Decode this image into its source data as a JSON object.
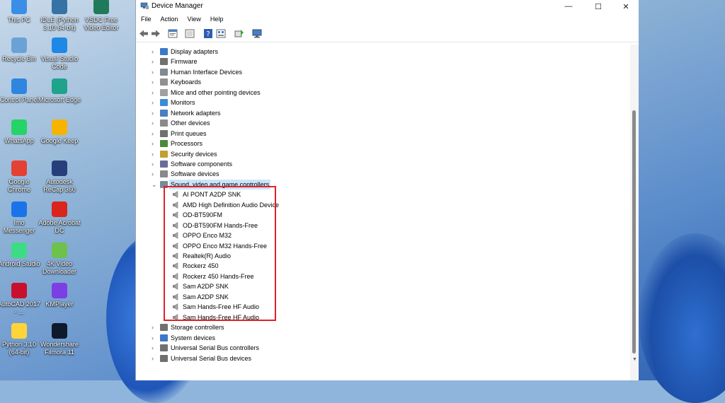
{
  "desktop": {
    "icons": [
      {
        "label": "This PC",
        "icon": "pc-icon",
        "color": "#3a8ee6"
      },
      {
        "label": "IDLE (Python 3.10 64-bit)",
        "icon": "python-idle-icon",
        "color": "#3572a5"
      },
      {
        "label": "VSDC Free Video Editor",
        "icon": "vsdc-icon",
        "color": "#1f7a5a"
      },
      {
        "label": "Recycle Bin",
        "icon": "recycle-bin-icon",
        "color": "#6aa2d8"
      },
      {
        "label": "Visual Studio Code",
        "icon": "vscode-icon",
        "color": "#1e88e5"
      },
      {
        "label": "Control Panel",
        "icon": "control-panel-icon",
        "color": "#2e86de"
      },
      {
        "label": "Microsoft Edge",
        "icon": "edge-icon",
        "color": "#1fa38a"
      },
      {
        "label": "WhatsApp",
        "icon": "whatsapp-icon",
        "color": "#25d366"
      },
      {
        "label": "Google Keep",
        "icon": "google-keep-icon",
        "color": "#f6b400"
      },
      {
        "label": "Google Chrome",
        "icon": "chrome-icon",
        "color": "#e44134"
      },
      {
        "label": "Autodesk ReCap 360",
        "icon": "recap-icon",
        "color": "#263f7a"
      },
      {
        "label": "Imo Messenger",
        "icon": "imo-icon",
        "color": "#1a73e8"
      },
      {
        "label": "Adobe Acrobat DC",
        "icon": "acrobat-icon",
        "color": "#d9251c"
      },
      {
        "label": "Android Studio",
        "icon": "android-studio-icon",
        "color": "#3ddc84"
      },
      {
        "label": "4K Video Downloader",
        "icon": "4k-downloader-icon",
        "color": "#6cc24a"
      },
      {
        "label": "AutoCAD 2017 - ...",
        "icon": "autocad-icon",
        "color": "#c8102e"
      },
      {
        "label": "KMPlayer",
        "icon": "kmplayer-icon",
        "color": "#7b3fe4"
      },
      {
        "label": "Python 3.10 (64-bit)",
        "icon": "python-icon",
        "color": "#ffd43b"
      },
      {
        "label": "Wondershare Filmora 11",
        "icon": "filmora-icon",
        "color": "#0e1a2b"
      }
    ]
  },
  "window": {
    "title": "Device Manager",
    "controls": {
      "minimize": "—",
      "maximize": "☐",
      "close": "✕"
    },
    "menu": [
      "File",
      "Action",
      "View",
      "Help"
    ],
    "toolbar": [
      "back-icon",
      "forward-icon",
      "properties-icon",
      "show-hidden-icon",
      "help-icon",
      "view-icon",
      "update-driver-icon",
      "scan-hardware-icon"
    ]
  },
  "tree": {
    "categories_before": [
      {
        "label": "Display adapters",
        "icon": "display-adapter-icon",
        "color": "#3c78c8"
      },
      {
        "label": "Firmware",
        "icon": "firmware-icon",
        "color": "#707070"
      },
      {
        "label": "Human Interface Devices",
        "icon": "hid-icon",
        "color": "#808890"
      },
      {
        "label": "Keyboards",
        "icon": "keyboard-icon",
        "color": "#909090"
      },
      {
        "label": "Mice and other pointing devices",
        "icon": "mouse-icon",
        "color": "#a0a0a0"
      },
      {
        "label": "Monitors",
        "icon": "monitor-icon",
        "color": "#3c8ad8"
      },
      {
        "label": "Network adapters",
        "icon": "network-adapter-icon",
        "color": "#4a7ec0"
      },
      {
        "label": "Other devices",
        "icon": "other-devices-icon",
        "color": "#8a8a8a"
      },
      {
        "label": "Print queues",
        "icon": "printer-icon",
        "color": "#707070"
      },
      {
        "label": "Processors",
        "icon": "processor-icon",
        "color": "#4a8a3a"
      },
      {
        "label": "Security devices",
        "icon": "security-device-icon",
        "color": "#c0a030"
      },
      {
        "label": "Software components",
        "icon": "software-component-icon",
        "color": "#6a6a9a"
      },
      {
        "label": "Software devices",
        "icon": "software-device-icon",
        "color": "#8a8a8a"
      }
    ],
    "expanded": {
      "label": "Sound, video and game controllers",
      "icon": "sound-controller-icon",
      "color": "#7a8a9a"
    },
    "children": [
      "AI PONT A2DP SNK",
      "AMD High Definition Audio Device",
      "OD-BT590FM",
      "OD-BT590FM Hands-Free",
      "OPPO Enco M32",
      "OPPO Enco M32 Hands-Free",
      "Realtek(R) Audio",
      "Rockerz 450",
      "Rockerz 450 Hands-Free",
      "Sam A2DP SNK",
      "Sam A2DP SNK",
      "Sam Hands-Free HF Audio",
      "Sam Hands-Free HF Audio"
    ],
    "categories_after": [
      {
        "label": "Storage controllers",
        "icon": "storage-controller-icon",
        "color": "#707070"
      },
      {
        "label": "System devices",
        "icon": "system-device-icon",
        "color": "#3c78c8"
      },
      {
        "label": "Universal Serial Bus controllers",
        "icon": "usb-controller-icon",
        "color": "#707070"
      },
      {
        "label": "Universal Serial Bus devices",
        "icon": "usb-device-icon",
        "color": "#707070"
      }
    ],
    "highlight_color": "#e0202a"
  }
}
